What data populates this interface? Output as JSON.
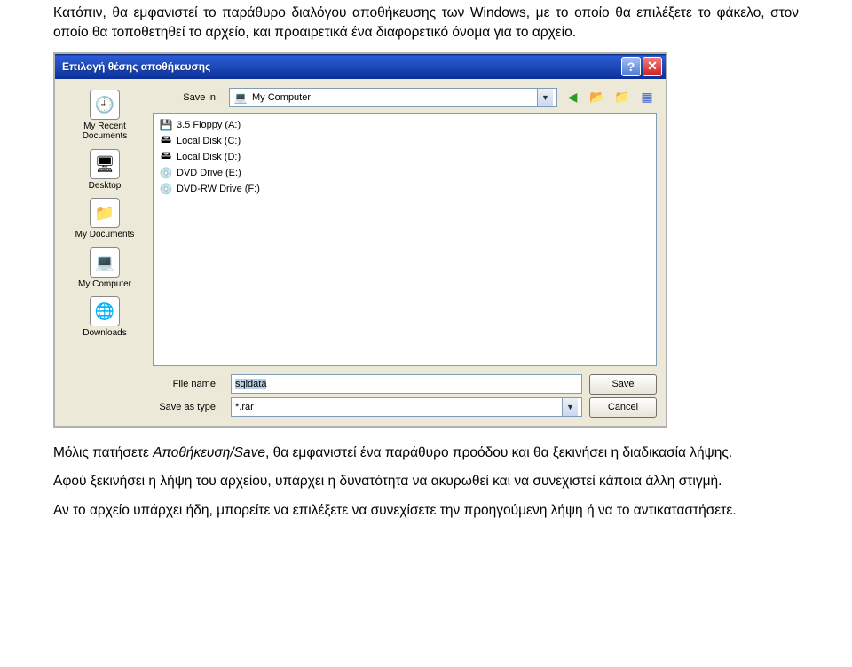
{
  "paragraphs": {
    "intro": "Κατόπιν, θα εμφανιστεί το παράθυρο διαλόγου αποθήκευσης των Windows, με το οποίο θα επιλέξετε το φάκελο, στον οποίο θα τοποθετηθεί το αρχείο, και προαιρετικά ένα διαφορετικό όνομα για το αρχείο.",
    "after1_prefix": "Μόλις πατήσετε ",
    "after1_italic": "Αποθήκευση/Save",
    "after1_suffix": ", θα εμφανιστεί ένα παράθυρο προόδου και θα ξεκινήσει η διαδικασία λήψης.",
    "after2": "Αφού ξεκινήσει η λήψη του αρχείου, υπάρχει η δυνατότητα να ακυρωθεί και να συνεχιστεί κάποια άλλη στιγμή.",
    "after3": "Αν το αρχείο υπάρχει ήδη, μπορείτε να επιλέξετε να συνεχίσετε την προηγούμενη λήψη ή να το αντικαταστήσετε."
  },
  "dialog": {
    "title": "Επιλογή θέσης αποθήκευσης",
    "save_in_label": "Save in:",
    "save_in_value": "My Computer",
    "file_name_label": "File name:",
    "file_name_value": "sqldata",
    "save_as_type_label": "Save as type:",
    "save_as_type_value": "*.rar",
    "save_btn": "Save",
    "cancel_btn": "Cancel"
  },
  "sidebar": {
    "items": [
      {
        "label": "My Recent Documents",
        "icon": "🕘"
      },
      {
        "label": "Desktop",
        "icon": "🖥"
      },
      {
        "label": "My Documents",
        "icon": "📁"
      },
      {
        "label": "My Computer",
        "icon": "💻"
      },
      {
        "label": "Downloads",
        "icon": "🌐"
      }
    ]
  },
  "files": {
    "items": [
      {
        "label": "3.5 Floppy (A:)",
        "icon": "💾"
      },
      {
        "label": "Local Disk (C:)",
        "icon": "🖴"
      },
      {
        "label": "Local Disk (D:)",
        "icon": "🖴"
      },
      {
        "label": "DVD Drive (E:)",
        "icon": "💿"
      },
      {
        "label": "DVD-RW Drive (F:)",
        "icon": "💿"
      }
    ]
  }
}
